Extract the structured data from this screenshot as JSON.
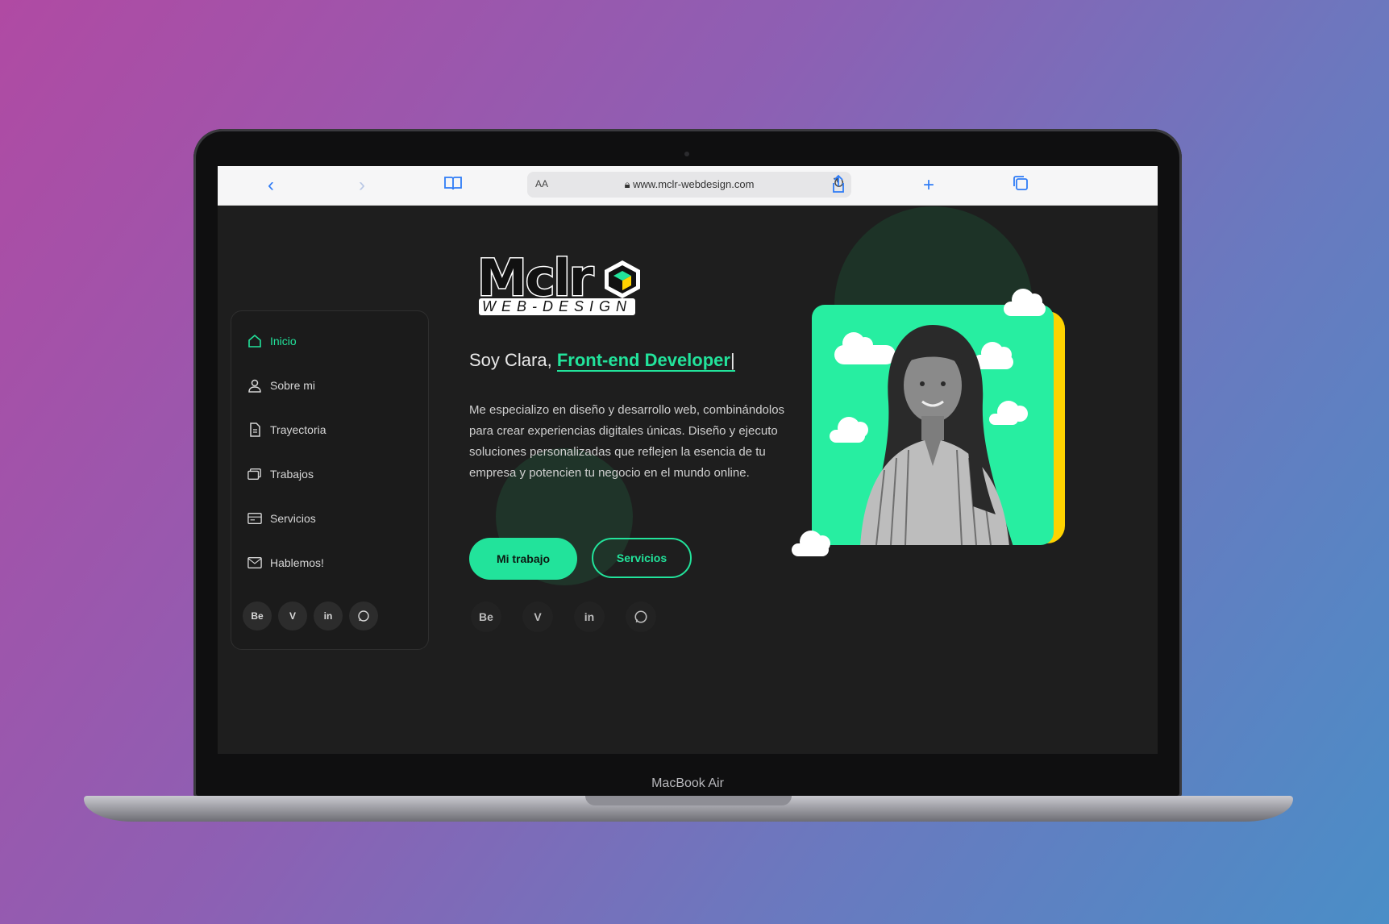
{
  "browser": {
    "url": "www.mclr-webdesign.com",
    "text_size_label": "AA",
    "icons": [
      "back-icon",
      "forward-icon",
      "bookmarks-icon",
      "lock-icon",
      "reload-icon",
      "share-icon",
      "new-tab-icon",
      "tabs-icon"
    ]
  },
  "sidebar": {
    "items": [
      {
        "label": "Inicio",
        "icon": "home-icon",
        "active": true
      },
      {
        "label": "Sobre mi",
        "icon": "user-icon",
        "active": false
      },
      {
        "label": "Trayectoria",
        "icon": "document-icon",
        "active": false
      },
      {
        "label": "Trabajos",
        "icon": "gallery-icon",
        "active": false
      },
      {
        "label": "Servicios",
        "icon": "services-icon",
        "active": false
      },
      {
        "label": "Hablemos!",
        "icon": "mail-icon",
        "active": false
      }
    ],
    "social": [
      {
        "label": "Be",
        "icon": "behance-icon"
      },
      {
        "label": "V",
        "icon": "vimeo-icon"
      },
      {
        "label": "in",
        "icon": "linkedin-icon"
      },
      {
        "label": "",
        "icon": "whatsapp-icon"
      }
    ]
  },
  "logo": {
    "word": "Mclr",
    "subtitle": "WEB-DESIGN"
  },
  "hero": {
    "greeting": "Soy Clara, ",
    "role": "Front-end Developer",
    "cursor": "|",
    "bio": "Me especializo en diseño y desarrollo web, combinándolos para crear experiencias digitales únicas. Diseño y ejecuto soluciones personalizadas que reflejen la esencia de tu empresa y potencien tu negocio en el mundo online.",
    "primary_button": "Mi trabajo",
    "secondary_button": "Servicios"
  },
  "main_social": [
    {
      "label": "Be",
      "icon": "behance-icon"
    },
    {
      "label": "V",
      "icon": "vimeo-icon"
    },
    {
      "label": "in",
      "icon": "linkedin-icon"
    },
    {
      "label": "",
      "icon": "whatsapp-icon"
    }
  ],
  "device_label": "MacBook Air",
  "colors": {
    "accent": "#22e39b",
    "highlight": "#ffd300",
    "page_bg": "#1e1e1e"
  }
}
